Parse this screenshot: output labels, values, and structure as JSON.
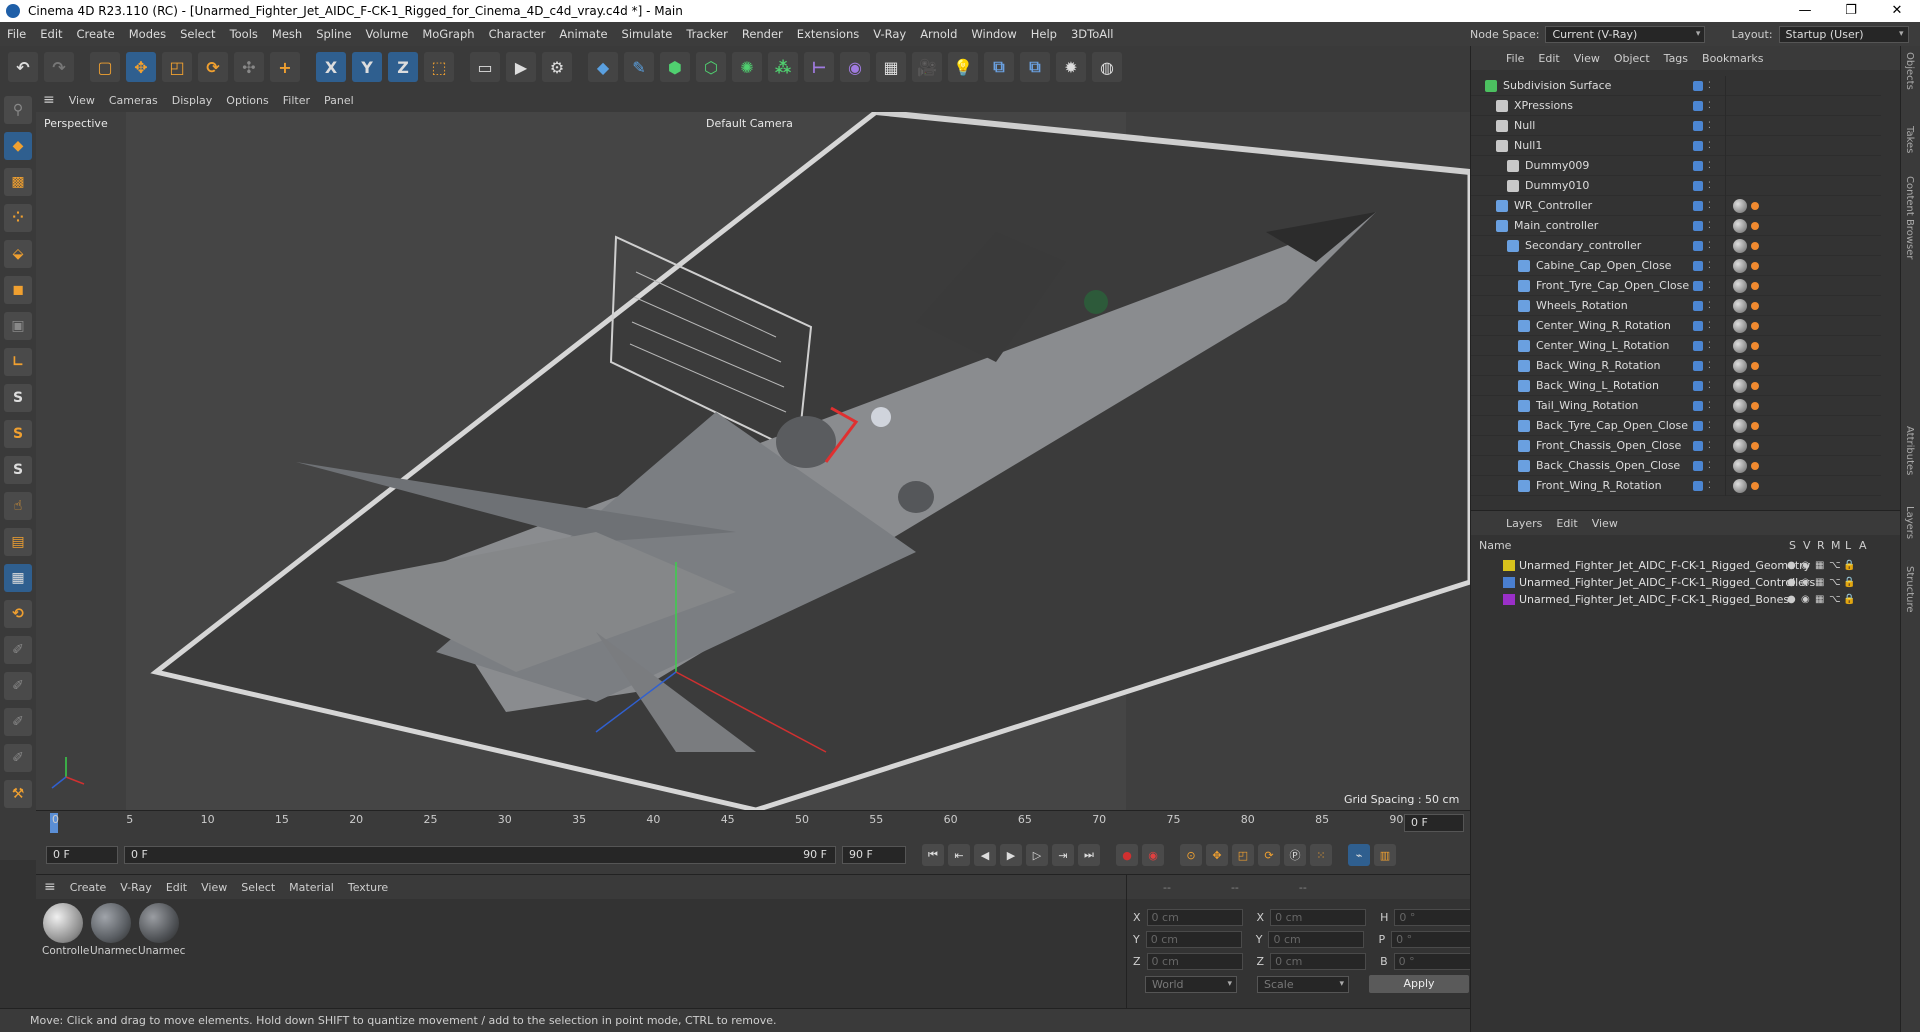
{
  "window": {
    "title": "Cinema 4D R23.110 (RC) - [Unarmed_Fighter_Jet_AIDC_F-CK-1_Rigged_for_Cinema_4D_c4d_vray.c4d *] - Main"
  },
  "menu": [
    "File",
    "Edit",
    "Create",
    "Modes",
    "Select",
    "Tools",
    "Mesh",
    "Spline",
    "Volume",
    "MoGraph",
    "Character",
    "Animate",
    "Simulate",
    "Tracker",
    "Render",
    "Extensions",
    "V-Ray",
    "Arnold",
    "Window",
    "Help",
    "3DToAll"
  ],
  "nodespace": {
    "label": "Node Space:",
    "value": "Current (V-Ray)",
    "layout_label": "Layout:",
    "layout_value": "Startup (User)"
  },
  "toolbar": {
    "x": "X",
    "y": "Y",
    "z": "Z"
  },
  "viewport": {
    "menu": [
      "View",
      "Cameras",
      "Display",
      "Options",
      "Filter",
      "Panel"
    ],
    "name": "Perspective",
    "camera": "Default Camera",
    "grid_spacing": "Grid Spacing : 50 cm"
  },
  "timeline": {
    "ticks": [
      "0",
      "5",
      "10",
      "15",
      "20",
      "25",
      "30",
      "35",
      "40",
      "45",
      "50",
      "55",
      "60",
      "65",
      "70",
      "75",
      "80",
      "85",
      "90"
    ],
    "end_frame": "0 F"
  },
  "transport": {
    "start": "0 F",
    "current": "0 F",
    "end_inner": "90 F",
    "end": "90 F"
  },
  "material_manager": {
    "menu": [
      "Create",
      "V-Ray",
      "Edit",
      "View",
      "Select",
      "Material",
      "Texture"
    ],
    "materials": [
      {
        "name": "Controlle",
        "color": "#c8c8c8"
      },
      {
        "name": "Unarmec",
        "color": "#6a6e74"
      },
      {
        "name": "Unarmec",
        "color": "#5e6166"
      }
    ]
  },
  "coordinates": {
    "header": [
      "--",
      "--",
      "--"
    ],
    "rows": [
      {
        "a": "X",
        "av": "0 cm",
        "b": "X",
        "bv": "0 cm",
        "c": "H",
        "cv": "0 °"
      },
      {
        "a": "Y",
        "av": "0 cm",
        "b": "Y",
        "bv": "0 cm",
        "c": "P",
        "cv": "0 °"
      },
      {
        "a": "Z",
        "av": "0 cm",
        "b": "Z",
        "bv": "0 cm",
        "c": "B",
        "cv": "0 °"
      }
    ],
    "mode": "World",
    "scale": "Scale",
    "apply": "Apply"
  },
  "status": "Move: Click and drag to move elements. Hold down SHIFT to quantize movement / add to the selection in point mode, CTRL to remove.",
  "object_manager": {
    "menu": [
      "File",
      "Edit",
      "View",
      "Object",
      "Tags",
      "Bookmarks"
    ],
    "objects": [
      {
        "name": "Subdivision Surface",
        "indent": 0
      },
      {
        "name": "XPressions",
        "indent": 1
      },
      {
        "name": "Null",
        "indent": 1
      },
      {
        "name": "Null1",
        "indent": 1
      },
      {
        "name": "Dummy009",
        "indent": 2
      },
      {
        "name": "Dummy010",
        "indent": 2
      },
      {
        "name": "WR_Controller",
        "indent": 1
      },
      {
        "name": "Main_controller",
        "indent": 1
      },
      {
        "name": "Secondary_controller",
        "indent": 2
      },
      {
        "name": "Cabine_Cap_Open_Close",
        "indent": 3
      },
      {
        "name": "Front_Tyre_Cap_Open_Close",
        "indent": 3
      },
      {
        "name": "Wheels_Rotation",
        "indent": 3
      },
      {
        "name": "Center_Wing_R_Rotation",
        "indent": 3
      },
      {
        "name": "Center_Wing_L_Rotation",
        "indent": 3
      },
      {
        "name": "Back_Wing_R_Rotation",
        "indent": 3
      },
      {
        "name": "Back_Wing_L_Rotation",
        "indent": 3
      },
      {
        "name": "Tail_Wing_Rotation",
        "indent": 3
      },
      {
        "name": "Back_Tyre_Cap_Open_Close",
        "indent": 3
      },
      {
        "name": "Front_Chassis_Open_Close",
        "indent": 3
      },
      {
        "name": "Back_Chassis_Open_Close",
        "indent": 3
      },
      {
        "name": "Front_Wing_R_Rotation",
        "indent": 3
      }
    ]
  },
  "layer_manager": {
    "menu": [
      "Layers",
      "Edit",
      "View"
    ],
    "header_name": "Name",
    "header_cols": [
      "S",
      "V",
      "R",
      "M",
      "L",
      "A"
    ],
    "layers": [
      {
        "name": "Unarmed_Fighter_Jet_AIDC_F-CK-1_Rigged_Geometry",
        "color": "#d8c21c"
      },
      {
        "name": "Unarmed_Fighter_Jet_AIDC_F-CK-1_Rigged_Controllers",
        "color": "#4a7fd0"
      },
      {
        "name": "Unarmed_Fighter_Jet_AIDC_F-CK-1_Rigged_Bones",
        "color": "#9a2fc8"
      }
    ]
  },
  "side_tabs": [
    "Objects",
    "Takes",
    "Content Browser",
    "Attributes",
    "Layers",
    "Structure"
  ]
}
